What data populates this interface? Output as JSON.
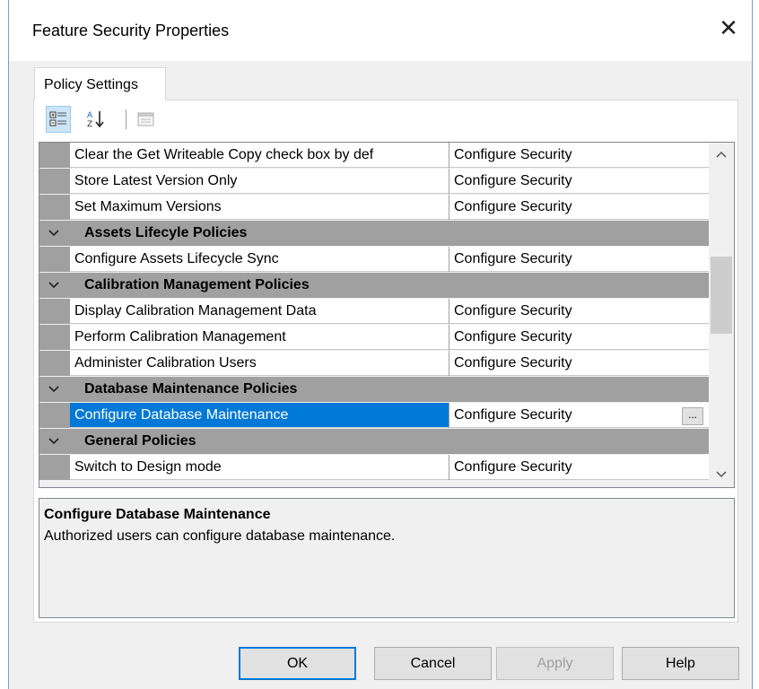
{
  "window": {
    "title": "Feature Security Properties",
    "close_glyph": "✕"
  },
  "tabs": [
    {
      "label": "Policy Settings"
    }
  ],
  "toolbar": {
    "buttons": [
      {
        "icon": "categorized-icon",
        "pressed": true
      },
      {
        "icon": "sort-alphabetical-icon",
        "pressed": false
      },
      {
        "icon": "property-pages-icon",
        "pressed": false,
        "disabled": true
      }
    ]
  },
  "grid": {
    "rows": [
      {
        "type": "property",
        "name": "Clear the Get Writeable Copy check box by def",
        "value": "Configure Security"
      },
      {
        "type": "property",
        "name": "Store Latest Version Only",
        "value": "Configure Security"
      },
      {
        "type": "property",
        "name": "Set Maximum Versions",
        "value": "Configure Security"
      },
      {
        "type": "category",
        "name": "Assets Lifecyle Policies"
      },
      {
        "type": "property",
        "name": "Configure Assets Lifecycle Sync",
        "value": "Configure Security"
      },
      {
        "type": "category",
        "name": "Calibration Management Policies"
      },
      {
        "type": "property",
        "name": "Display Calibration Management Data",
        "value": "Configure Security"
      },
      {
        "type": "property",
        "name": "Perform Calibration Management",
        "value": "Configure Security"
      },
      {
        "type": "property",
        "name": "Administer Calibration Users",
        "value": "Configure Security"
      },
      {
        "type": "category",
        "name": "Database Maintenance Policies"
      },
      {
        "type": "property",
        "name": "Configure Database Maintenance",
        "value": "Configure Security",
        "selected": true,
        "ellipsis": "..."
      },
      {
        "type": "category",
        "name": "General Policies"
      },
      {
        "type": "property",
        "name": "Switch to Design mode",
        "value": "Configure Security"
      }
    ],
    "selected_color": "#0078d7"
  },
  "description": {
    "title": "Configure Database Maintenance",
    "text": "Authorized users can configure database maintenance."
  },
  "buttons": {
    "ok": "OK",
    "cancel": "Cancel",
    "apply": "Apply",
    "help": "Help"
  }
}
